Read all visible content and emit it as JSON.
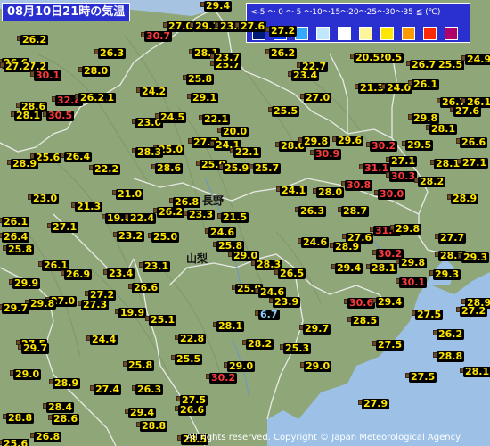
{
  "title": "08月10日21時の気温",
  "legend": {
    "scale": "<-5 ～ 0 ～ 5 ～10～15～20～25～30～35 ≦ (℃)",
    "colors": [
      "#001a7a",
      "#0033ff",
      "#33aaff",
      "#bfe7ff",
      "#ffffff",
      "#fff59d",
      "#ffe600",
      "#ff9900",
      "#ff2a00",
      "#b0006a"
    ]
  },
  "cities": [
    {
      "name": "長野"
    },
    {
      "name": "山梨"
    }
  ],
  "copyright": "All rights reserved. Copyright © Japan Meteorological Agency",
  "chart_data": {
    "type": "scatter",
    "unit": "℃",
    "observations": [
      {
        "value": "29.4"
      },
      {
        "value": "30.7"
      },
      {
        "value": "27.0"
      },
      {
        "value": "29.1"
      },
      {
        "value": "23.2"
      },
      {
        "value": "27.6"
      },
      {
        "value": "27.2"
      },
      {
        "value": "26.2"
      },
      {
        "value": "20.5"
      },
      {
        "value": "25.5"
      },
      {
        "value": "27.2"
      },
      {
        "value": "26.3"
      },
      {
        "value": "28.1"
      },
      {
        "value": "25.7"
      },
      {
        "value": "23.7"
      },
      {
        "value": "26.2"
      },
      {
        "value": "22.7"
      },
      {
        "value": "20.5"
      },
      {
        "value": "26.7"
      },
      {
        "value": "24.9"
      },
      {
        "value": "26.6"
      },
      {
        "value": "27.2"
      },
      {
        "value": "30.1"
      },
      {
        "value": "28.0"
      },
      {
        "value": "25.8"
      },
      {
        "value": "23.4"
      },
      {
        "value": "21.3"
      },
      {
        "value": "24.0"
      },
      {
        "value": "26.1"
      },
      {
        "value": "24.2"
      },
      {
        "value": "29.1"
      },
      {
        "value": "26.1"
      },
      {
        "value": "28.6"
      },
      {
        "value": "32.8"
      },
      {
        "value": "26.2"
      },
      {
        "value": "27.0"
      },
      {
        "value": "26.7"
      },
      {
        "value": "26.1"
      },
      {
        "value": "28.1"
      },
      {
        "value": "30.5"
      },
      {
        "value": "23.0"
      },
      {
        "value": "24.5"
      },
      {
        "value": "22.1"
      },
      {
        "value": "25.5"
      },
      {
        "value": "29.8"
      },
      {
        "value": "27.6"
      },
      {
        "value": "28.1"
      },
      {
        "value": "20.0"
      },
      {
        "value": "27.7"
      },
      {
        "value": "24.1"
      },
      {
        "value": "28.0"
      },
      {
        "value": "29.8"
      },
      {
        "value": "29.6"
      },
      {
        "value": "30.2"
      },
      {
        "value": "29.5"
      },
      {
        "value": "26.6"
      },
      {
        "value": "25.0"
      },
      {
        "value": "25.6"
      },
      {
        "value": "28.3"
      },
      {
        "value": "22.1"
      },
      {
        "value": "30.9"
      },
      {
        "value": "27.1"
      },
      {
        "value": "26.4"
      },
      {
        "value": "25.0"
      },
      {
        "value": "25.9"
      },
      {
        "value": "25.7"
      },
      {
        "value": "31.1"
      },
      {
        "value": "28.1"
      },
      {
        "value": "28.9"
      },
      {
        "value": "22.2"
      },
      {
        "value": "28.6"
      },
      {
        "value": "30.3"
      },
      {
        "value": "27.1"
      },
      {
        "value": "30.8"
      },
      {
        "value": "28.2"
      },
      {
        "value": "21.0"
      },
      {
        "value": "24.1"
      },
      {
        "value": "28.0"
      },
      {
        "value": "30.0"
      },
      {
        "value": "23.0"
      },
      {
        "value": "26.8"
      },
      {
        "value": "28.9"
      },
      {
        "value": "21.3"
      },
      {
        "value": "26.2"
      },
      {
        "value": "23.3"
      },
      {
        "value": "26.3"
      },
      {
        "value": "28.7"
      },
      {
        "value": "26.1"
      },
      {
        "value": "27.1"
      },
      {
        "value": "19.0"
      },
      {
        "value": "22.4"
      },
      {
        "value": "21.5"
      },
      {
        "value": "31.6"
      },
      {
        "value": "29.8"
      },
      {
        "value": "26.4"
      },
      {
        "value": "27.6"
      },
      {
        "value": "24.6"
      },
      {
        "value": "27.7"
      },
      {
        "value": "23.2"
      },
      {
        "value": "25.0"
      },
      {
        "value": "25.8"
      },
      {
        "value": "24.6"
      },
      {
        "value": "28.9"
      },
      {
        "value": "30.2"
      },
      {
        "value": "25.8"
      },
      {
        "value": "29.0"
      },
      {
        "value": "28.3"
      },
      {
        "value": "29.3"
      },
      {
        "value": "29.8"
      },
      {
        "value": "26.1"
      },
      {
        "value": "23.1"
      },
      {
        "value": "28.3"
      },
      {
        "value": "29.4"
      },
      {
        "value": "28.1"
      },
      {
        "value": "26.9"
      },
      {
        "value": "23.4"
      },
      {
        "value": "26.5"
      },
      {
        "value": "29.3"
      },
      {
        "value": "29.9"
      },
      {
        "value": "26.6"
      },
      {
        "value": "25.0"
      },
      {
        "value": "24.6"
      },
      {
        "value": "30.1"
      },
      {
        "value": "27.2"
      },
      {
        "value": "27.0"
      },
      {
        "value": "23.9"
      },
      {
        "value": "28.9"
      },
      {
        "value": "29.8"
      },
      {
        "value": "27.3"
      },
      {
        "value": "30.6"
      },
      {
        "value": "29.4"
      },
      {
        "value": "27.5"
      },
      {
        "value": "29.7"
      },
      {
        "value": "19.9"
      },
      {
        "value": "25.1"
      },
      {
        "value": "6.7"
      },
      {
        "value": "28.5"
      },
      {
        "value": "27.2"
      },
      {
        "value": "28.1"
      },
      {
        "value": "29.7"
      },
      {
        "value": "26.2"
      },
      {
        "value": "27.5"
      },
      {
        "value": "24.4"
      },
      {
        "value": "22.8"
      },
      {
        "value": "28.2"
      },
      {
        "value": "25.3"
      },
      {
        "value": "27.5"
      },
      {
        "value": "29.7"
      },
      {
        "value": "28.8"
      },
      {
        "value": "25.8"
      },
      {
        "value": "25.5"
      },
      {
        "value": "29.0"
      },
      {
        "value": "29.0"
      },
      {
        "value": "29.0"
      },
      {
        "value": "28.9"
      },
      {
        "value": "27.4"
      },
      {
        "value": "26.3"
      },
      {
        "value": "30.2"
      },
      {
        "value": "27.5"
      },
      {
        "value": "28.1"
      },
      {
        "value": "28.4"
      },
      {
        "value": "27.5"
      },
      {
        "value": "27.9"
      },
      {
        "value": "26.6"
      },
      {
        "value": "29.4"
      },
      {
        "value": "28.8"
      },
      {
        "value": "28.6"
      },
      {
        "value": "28.8"
      },
      {
        "value": "28.5"
      },
      {
        "value": "26.8"
      },
      {
        "value": "25.6"
      }
    ]
  }
}
